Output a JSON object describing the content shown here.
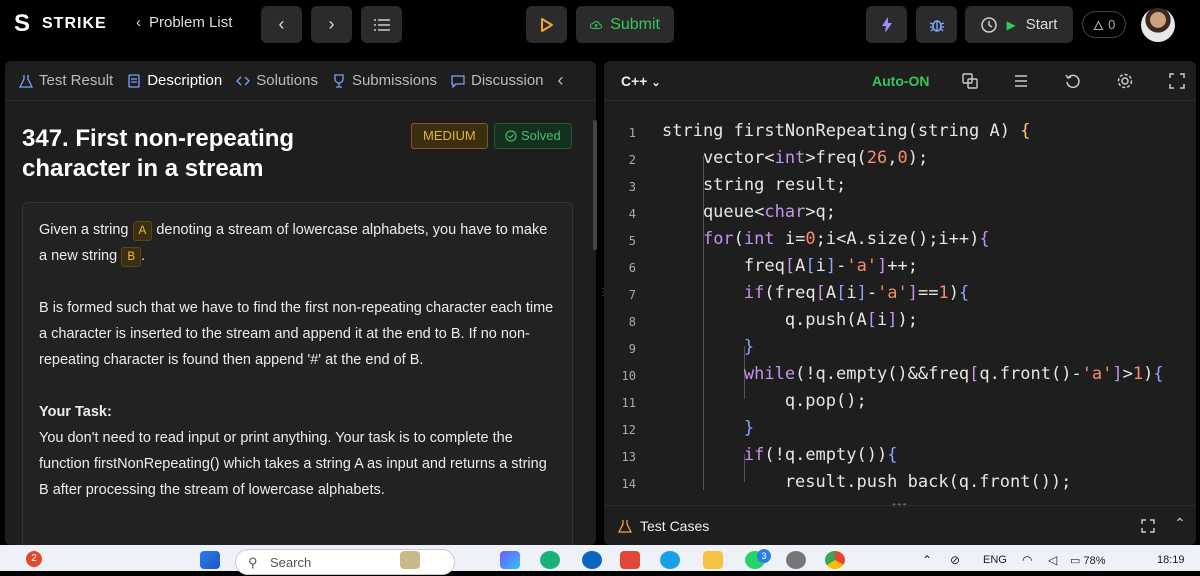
{
  "app": {
    "name": "STRIKE",
    "logo_glyph": "S"
  },
  "topbar": {
    "back_label": "Problem List",
    "submit_label": "Submit",
    "start_label": "Start",
    "counter": "0"
  },
  "left_tabs": [
    {
      "label": "Test Result",
      "icon": "flask-icon"
    },
    {
      "label": "Description",
      "icon": "document-icon"
    },
    {
      "label": "Solutions",
      "icon": "code-icon"
    },
    {
      "label": "Submissions",
      "icon": "trophy-icon"
    },
    {
      "label": "Discussion",
      "icon": "chat-icon"
    }
  ],
  "problem": {
    "title": "347. First non-repeating character in a stream",
    "difficulty": "MEDIUM",
    "status": "Solved",
    "p1_a": "Given a string ",
    "chip_a": "A",
    "p1_b": " denoting a stream of lowercase alphabets, you have to make a new string ",
    "chip_b": "B",
    "p1_c": ".",
    "p2": "B is formed such that we have to find the first non-repeating character each time a character is inserted to the stream and append it at the end to B. If no non-repeating character is found then append '#' at the end of B.",
    "task_heading": "Your Task:",
    "task_text": "You don't need to read input or print anything. Your task is to complete the function firstNonRepeating() which takes a string A as input and returns a string B after processing the stream of lowercase alphabets."
  },
  "editor": {
    "language": "C++",
    "autosave": "Auto-ON",
    "line_numbers": [
      "1",
      "2",
      "3",
      "4",
      "5",
      "6",
      "7",
      "8",
      "9",
      "10",
      "11",
      "12",
      "13",
      "14"
    ]
  },
  "bottom_panel": {
    "label": "Test Cases"
  },
  "taskbar": {
    "search_placeholder": "Search",
    "notification_count": "2",
    "whatsapp_count": "3",
    "language": "ENG",
    "battery": "78%",
    "time": "18:19"
  },
  "colors": {
    "accent_green": "#34c759",
    "medium_badge": "#e4b237",
    "run_orange": "#f1a33c"
  }
}
